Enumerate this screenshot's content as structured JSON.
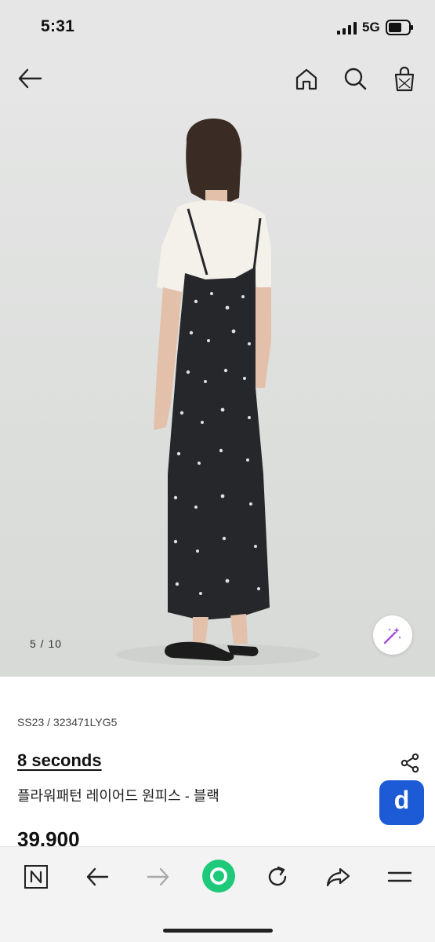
{
  "status_bar": {
    "time": "5:31",
    "network": "5G",
    "signal_icon": "signal-bars-icon",
    "battery_icon": "battery-icon"
  },
  "nav": {
    "back_icon": "arrow-left-icon",
    "home_icon": "home-icon",
    "search_icon": "search-icon",
    "bag_icon": "shopping-bag-icon"
  },
  "gallery": {
    "current": 5,
    "total": 10,
    "counter_text": "5  /  10",
    "magic_icon": "magic-wand-icon"
  },
  "product": {
    "code": "SS23 / 323471LYG5",
    "brand": "8 seconds",
    "name": "플라워패턴 레이어드 원피스 - 블랙",
    "price": "39.900",
    "share_icon": "share-icon",
    "d_button_label": "d"
  },
  "toolbar": {
    "items": [
      "n-tab-icon",
      "back-icon",
      "forward-icon",
      "green-dot-icon",
      "reload-icon",
      "share-arrow-icon",
      "menu-icon"
    ]
  },
  "colors": {
    "accent_blue": "#1d5bd6",
    "green_dot": "#1ec97a",
    "magic_purple": "#a24fd6"
  }
}
